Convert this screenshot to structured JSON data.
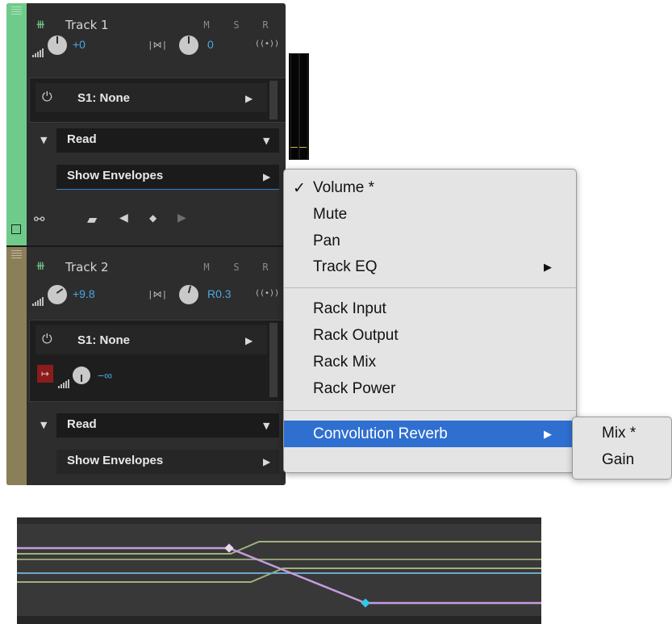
{
  "tracks": [
    {
      "name": "Track 1",
      "buttons": [
        "M",
        "S",
        "R",
        "I"
      ],
      "volume": "+0",
      "pan": "0",
      "send_slot": "S1: None",
      "automation_mode": "Read",
      "envelopes_label": "Show Envelopes",
      "color": "#6fcb8a"
    },
    {
      "name": "Track 2",
      "buttons": [
        "M",
        "S",
        "R"
      ],
      "volume": "+9.8",
      "pan": "R0.3",
      "send_slot": "S1: None",
      "send_volume": "−∞",
      "automation_mode": "Read",
      "envelopes_label": "Show Envelopes",
      "color": "#8a7f58"
    }
  ],
  "menu": {
    "items": [
      {
        "label": "Volume *",
        "checked": true,
        "submenu": false
      },
      {
        "label": "Mute",
        "checked": false,
        "submenu": false
      },
      {
        "label": "Pan",
        "checked": false,
        "submenu": false
      },
      {
        "label": "Track EQ",
        "checked": false,
        "submenu": true
      },
      {
        "label": "Rack Input",
        "checked": false,
        "submenu": false
      },
      {
        "label": "Rack Output",
        "checked": false,
        "submenu": false
      },
      {
        "label": "Rack Mix",
        "checked": false,
        "submenu": false
      },
      {
        "label": "Rack Power",
        "checked": false,
        "submenu": false
      },
      {
        "label": "Convolution Reverb",
        "checked": false,
        "submenu": true,
        "highlighted": true
      }
    ],
    "check_glyph": "✓",
    "submenu_arrow": "▶"
  },
  "submenu": {
    "items": [
      "Mix *",
      "Gain"
    ]
  },
  "colors": {
    "highlight": "#2f6fd0",
    "value_blue": "#4aa8e6",
    "envelope_purple": "#c79be0",
    "envelope_green": "#9fb27c",
    "envelope_blue": "#6da8c9",
    "keyframe_cyan": "#35c6e8"
  }
}
